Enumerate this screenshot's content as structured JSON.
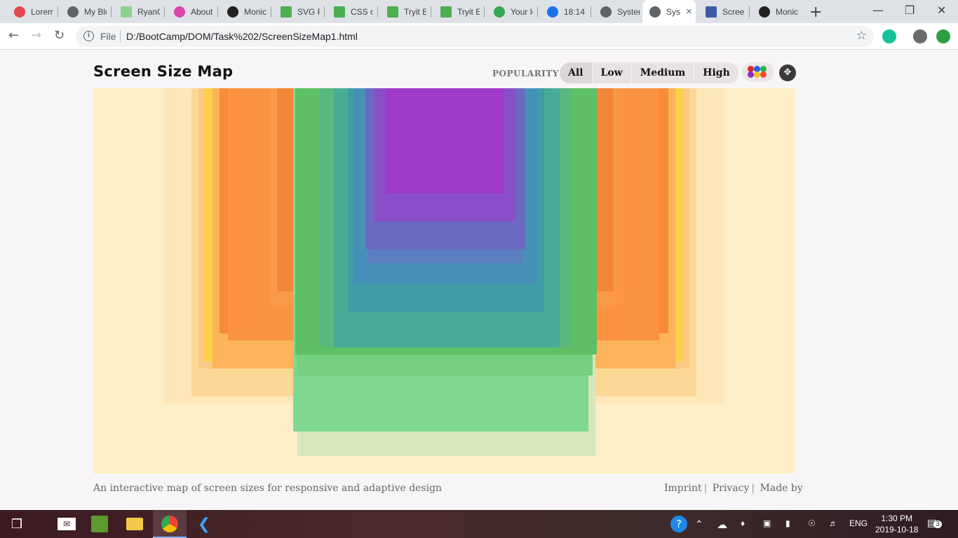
{
  "browser": {
    "tabs": [
      {
        "title": "Lorem",
        "icon": "lorem-favicon",
        "color": "#e8474f"
      },
      {
        "title": "My Blc",
        "icon": "globe-icon",
        "color": "#5f6368"
      },
      {
        "title": "RyanC",
        "icon": "repl-icon",
        "color": "#8fd08f"
      },
      {
        "title": "About",
        "icon": "swirl-icon",
        "color": "#d946a8"
      },
      {
        "title": "Monic",
        "icon": "github-icon",
        "color": "#222"
      },
      {
        "title": "SVG Re",
        "icon": "w3-icon",
        "color": "#4caf50"
      },
      {
        "title": "CSS op",
        "icon": "w3-icon",
        "color": "#4caf50"
      },
      {
        "title": "Tryit Ec",
        "icon": "w3-icon",
        "color": "#4caf50"
      },
      {
        "title": "Tryit Ec",
        "icon": "w3-icon",
        "color": "#4caf50"
      },
      {
        "title": "Your Ic",
        "icon": "maps-icon",
        "color": "#34a853"
      },
      {
        "title": "18:14",
        "icon": "refresh-icon",
        "color": "#1a73e8"
      },
      {
        "title": "System",
        "icon": "globe-icon",
        "color": "#5f6368"
      },
      {
        "title": "Sys",
        "icon": "globe-icon",
        "color": "#5f6368"
      },
      {
        "title": "Screen",
        "icon": "screen-icon",
        "color": "#3b5ba8"
      },
      {
        "title": "Monic",
        "icon": "github-icon",
        "color": "#222"
      }
    ],
    "active_tab_index": 12,
    "file_label": "File",
    "url": "D:/BootCamp/DOM/Task%202/ScreenSizeMap1.html"
  },
  "page": {
    "title": "Screen Size Map",
    "popularity_label": "POPULARITY",
    "filters": [
      "All",
      "Low",
      "Medium",
      "High"
    ],
    "selected_filter": "All",
    "description": "An interactive map of screen sizes for responsive and adaptive design",
    "footer_links": [
      "Imprint",
      "Privacy",
      "Made by"
    ]
  },
  "colors": {
    "map_background": "#fdeec8",
    "page_background": "#f7f5f7",
    "accent_orange": "#f98a36",
    "accent_green": "#5fbf64",
    "accent_teal": "#3d9ba8",
    "accent_purple": "#9f3ac8"
  },
  "taskbar": {
    "time": "1:30 PM",
    "date": "2019-10-18",
    "language": "ENG",
    "notifications": "3"
  }
}
